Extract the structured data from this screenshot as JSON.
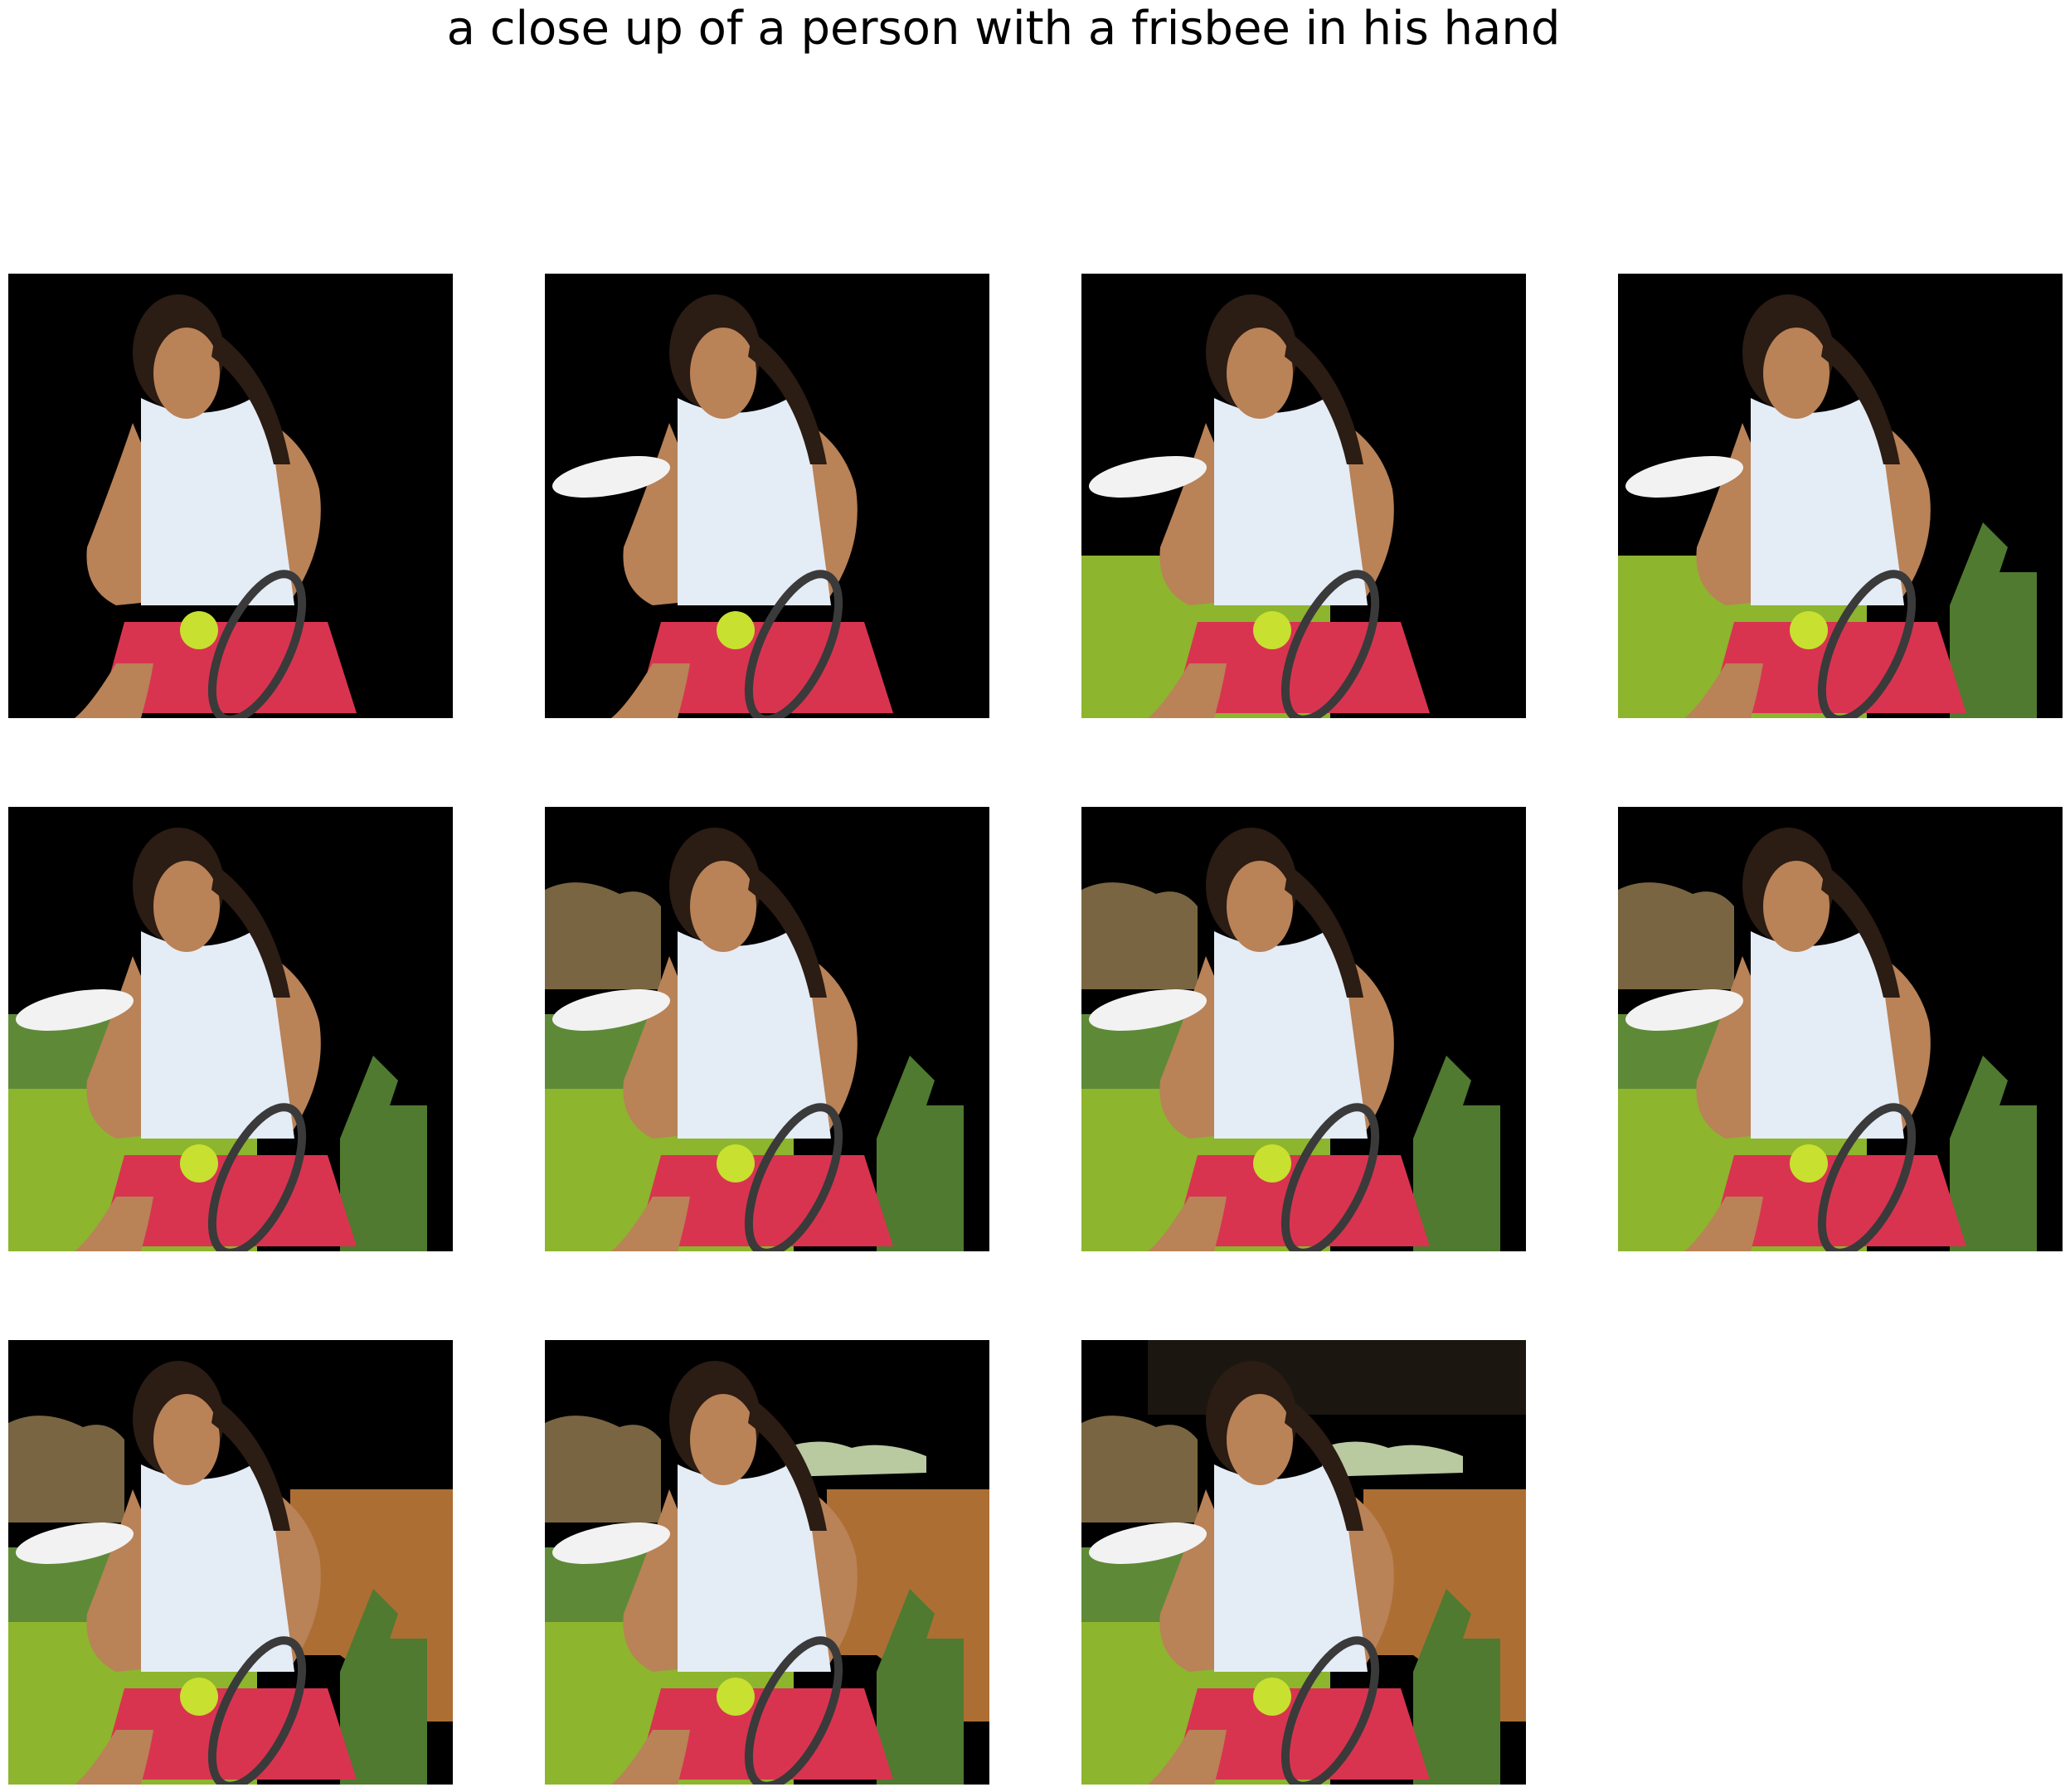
{
  "caption": "a close up of a person with a frisbee in his hand",
  "panels": [
    {
      "id": 1,
      "frisbee": false,
      "grass": false,
      "right_hedge": false,
      "left_bush": false,
      "top_bush": false,
      "flowers": false,
      "top_right_shrub": false,
      "dark_top": false
    },
    {
      "id": 2,
      "frisbee": true,
      "grass": false,
      "right_hedge": false,
      "left_bush": false,
      "top_bush": false,
      "flowers": false,
      "top_right_shrub": false,
      "dark_top": false
    },
    {
      "id": 3,
      "frisbee": true,
      "grass": true,
      "right_hedge": false,
      "left_bush": false,
      "top_bush": false,
      "flowers": false,
      "top_right_shrub": false,
      "dark_top": false
    },
    {
      "id": 4,
      "frisbee": true,
      "grass": true,
      "right_hedge": true,
      "left_bush": false,
      "top_bush": false,
      "flowers": false,
      "top_right_shrub": false,
      "dark_top": false
    },
    {
      "id": 5,
      "frisbee": true,
      "grass": true,
      "right_hedge": true,
      "left_bush": true,
      "top_bush": false,
      "flowers": false,
      "top_right_shrub": false,
      "dark_top": false
    },
    {
      "id": 6,
      "frisbee": true,
      "grass": true,
      "right_hedge": true,
      "left_bush": true,
      "top_bush": true,
      "flowers": false,
      "top_right_shrub": false,
      "dark_top": false
    },
    {
      "id": 7,
      "frisbee": true,
      "grass": true,
      "right_hedge": true,
      "left_bush": true,
      "top_bush": true,
      "flowers": false,
      "top_right_shrub": false,
      "dark_top": false
    },
    {
      "id": 8,
      "frisbee": true,
      "grass": true,
      "right_hedge": true,
      "left_bush": true,
      "top_bush": true,
      "flowers": false,
      "top_right_shrub": false,
      "dark_top": false
    },
    {
      "id": 9,
      "frisbee": true,
      "grass": true,
      "right_hedge": true,
      "left_bush": true,
      "top_bush": true,
      "flowers": true,
      "top_right_shrub": false,
      "dark_top": false
    },
    {
      "id": 10,
      "frisbee": true,
      "grass": true,
      "right_hedge": true,
      "left_bush": true,
      "top_bush": true,
      "flowers": true,
      "top_right_shrub": true,
      "dark_top": false
    },
    {
      "id": 11,
      "frisbee": true,
      "grass": true,
      "right_hedge": true,
      "left_bush": true,
      "top_bush": true,
      "flowers": true,
      "top_right_shrub": true,
      "dark_top": true
    }
  ],
  "colors": {
    "background": "#000000",
    "grass": "#8db52e",
    "grass_light": "#a8c83a",
    "hedge": "#4f7a2f",
    "bush": "#7f6a45",
    "flowers": "#c07a3a",
    "shirt": "#e4ecf6",
    "skirt": "#d83450",
    "skin": "#b98257",
    "hair": "#2b1c14",
    "ball": "#c8e030",
    "frisbee": "#f2f2f2"
  }
}
